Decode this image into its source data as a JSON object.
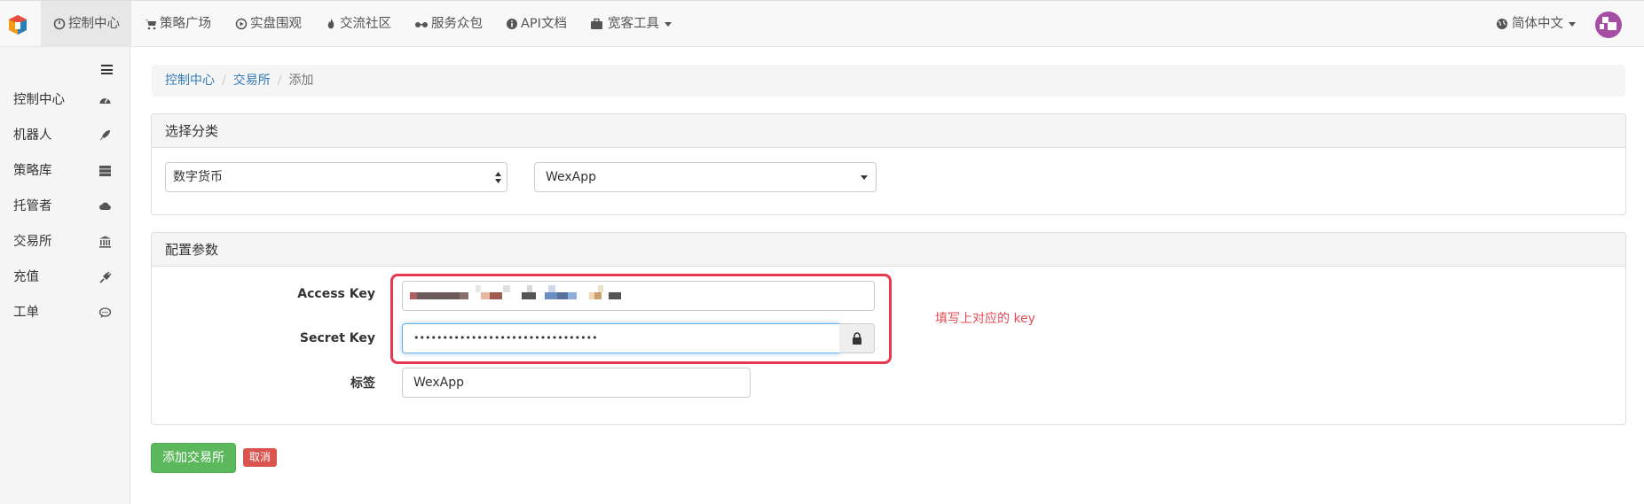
{
  "navbar": {
    "items": [
      {
        "label": "控制中心",
        "icon": "dashboard-icon"
      },
      {
        "label": "策略广场",
        "icon": "cart-icon"
      },
      {
        "label": "实盘围观",
        "icon": "play-circle-icon"
      },
      {
        "label": "交流社区",
        "icon": "fire-icon"
      },
      {
        "label": "服务众包",
        "icon": "glasses-icon"
      },
      {
        "label": "API文档",
        "icon": "info-circle-icon"
      },
      {
        "label": "宽客工具",
        "icon": "briefcase-icon"
      }
    ],
    "language": "简体中文"
  },
  "sidebar": {
    "items": [
      {
        "label": "控制中心",
        "icon": "dashboard-gauge-icon"
      },
      {
        "label": "机器人",
        "icon": "rocket-icon"
      },
      {
        "label": "策略库",
        "icon": "server-icon"
      },
      {
        "label": "托管者",
        "icon": "cloud-icon"
      },
      {
        "label": "交易所",
        "icon": "bank-icon"
      },
      {
        "label": "充值",
        "icon": "plug-icon"
      },
      {
        "label": "工单",
        "icon": "comment-icon"
      }
    ]
  },
  "breadcrumb": {
    "items": [
      "控制中心",
      "交易所"
    ],
    "current": "添加"
  },
  "category_panel": {
    "title": "选择分类",
    "category_select": "数字货币",
    "exchange_select": "WexApp"
  },
  "config_panel": {
    "title": "配置参数",
    "access_key_label": "Access Key",
    "secret_key_label": "Secret Key",
    "secret_key_value": "••••••••••••••••••••••••••••••••",
    "tag_label": "标签",
    "tag_value": "WexApp"
  },
  "annotation": "填写上对应的 key",
  "buttons": {
    "add": "添加交易所",
    "cancel": "取消"
  },
  "colors": {
    "primary_link": "#337ab7",
    "success": "#5cb85c",
    "danger": "#d9534f",
    "highlight": "#e6394f"
  }
}
